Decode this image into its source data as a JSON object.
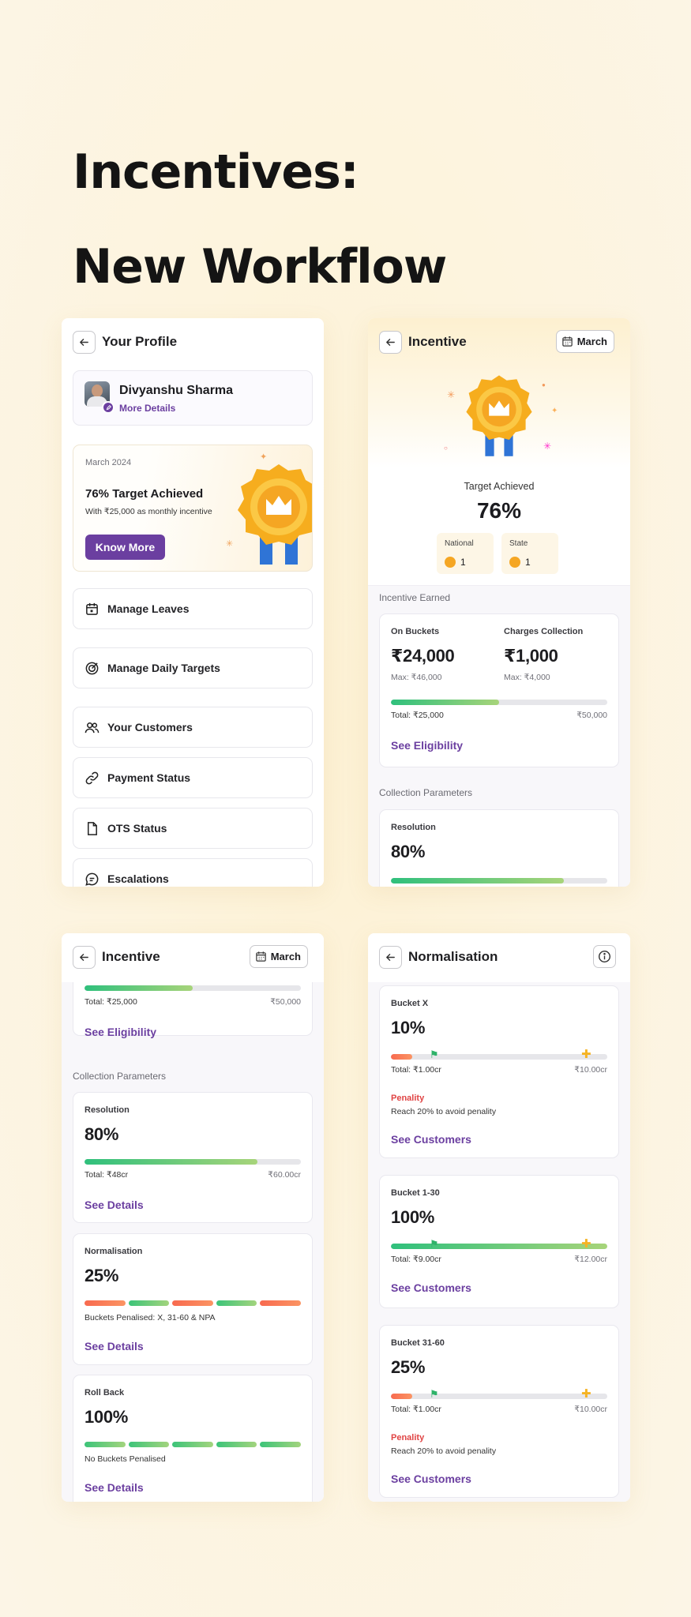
{
  "hero": {
    "line1": "Incentives:",
    "line2": "New Workflow"
  },
  "profile": {
    "title": "Your Profile",
    "user_name": "Divyanshu Sharma",
    "more_details": "More Details",
    "banner": {
      "month": "March 2024",
      "headline": "76% Target Achieved",
      "subtext": "With ₹25,000 as monthly incentive",
      "button": "Know More"
    },
    "menu": [
      {
        "label": "Manage Leaves",
        "icon": "calendar-icon"
      },
      {
        "label": "Manage Daily Targets",
        "icon": "target-icon"
      },
      {
        "label": "Your Customers",
        "icon": "users-icon"
      },
      {
        "label": "Payment Status",
        "icon": "link-icon"
      },
      {
        "label": "OTS Status",
        "icon": "file-icon"
      },
      {
        "label": "Escalations",
        "icon": "chat-icon"
      }
    ]
  },
  "incentive": {
    "title": "Incentive",
    "month": "March",
    "target_label": "Target Achieved",
    "target_value": "76%",
    "ranks": [
      {
        "label": "National",
        "value": "1"
      },
      {
        "label": "State",
        "value": "1"
      }
    ],
    "earned_section": "Incentive Earned",
    "on_buckets": {
      "label": "On Buckets",
      "value": "₹24,000",
      "max": "Max: ₹46,000"
    },
    "charges": {
      "label": "Charges Collection",
      "value": "₹1,000",
      "max": "Max: ₹4,000"
    },
    "total_progress": 0.5,
    "total_left": "Total: ₹25,000",
    "total_right": "₹50,000",
    "see_eligibility": "See Eligibility",
    "params_section": "Collection Parameters",
    "resolution": {
      "label": "Resolution",
      "value": "80%",
      "progress": 0.8,
      "total_left": "Total: ₹48cr",
      "total_right": "₹60.00cr",
      "link": "See Details"
    },
    "normalisation": {
      "label": "Normalisation",
      "value": "25%",
      "segments": [
        "red",
        "green",
        "red",
        "green",
        "red"
      ],
      "note": "Buckets Penalised: X, 31-60 & NPA",
      "link": "See Details"
    },
    "rollback": {
      "label": "Roll Back",
      "value": "100%",
      "segments": [
        "green",
        "green",
        "green",
        "green",
        "green"
      ],
      "note": "No Buckets Penalised",
      "link": "See Details"
    }
  },
  "normalisation_page": {
    "title": "Normalisation",
    "buckets": [
      {
        "label": "Bucket X",
        "value": "10%",
        "progress": 0.1,
        "total_left": "Total: ₹1.00cr",
        "total_right": "₹10.00cr",
        "penalty_label": "Penality",
        "penalty_note": "Reach 20% to avoid penality",
        "link": "See Customers"
      },
      {
        "label": "Bucket 1-30",
        "value": "100%",
        "progress": 1.0,
        "total_left": "Total: ₹9.00cr",
        "total_right": "₹12.00cr",
        "link": "See Customers"
      },
      {
        "label": "Bucket 31-60",
        "value": "25%",
        "progress": 0.1,
        "total_left": "Total: ₹1.00cr",
        "total_right": "₹10.00cr",
        "penalty_label": "Penality",
        "penalty_note": "Reach 20% to avoid penality",
        "link": "See Customers"
      }
    ]
  },
  "colors": {
    "brand_purple": "#6b3fa0",
    "progress_green": "#2fc07c",
    "penalty_red": "#e04444",
    "gold": "#f5b324"
  }
}
